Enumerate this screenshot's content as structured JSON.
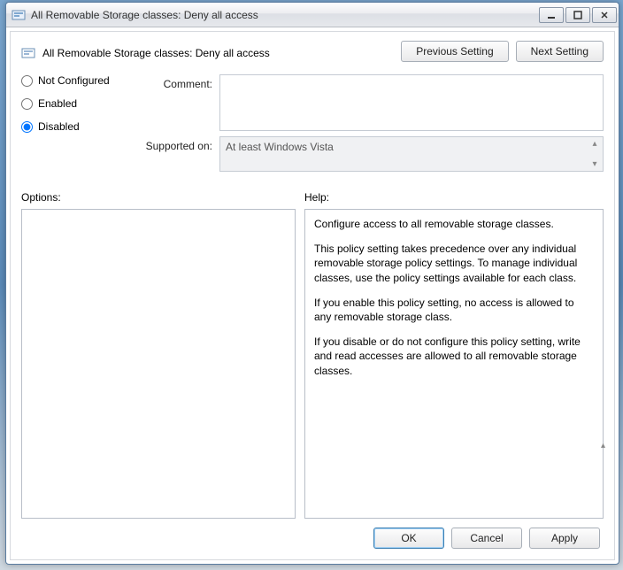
{
  "window": {
    "title": "All Removable Storage classes: Deny all access"
  },
  "header": {
    "policy_title": "All Removable Storage classes: Deny all access",
    "prev_label": "Previous Setting",
    "next_label": "Next Setting"
  },
  "radios": {
    "not_configured": "Not Configured",
    "enabled": "Enabled",
    "disabled": "Disabled",
    "selected": "disabled"
  },
  "fields": {
    "comment_label": "Comment:",
    "comment_value": "",
    "supported_label": "Supported on:",
    "supported_value": "At least Windows Vista"
  },
  "sections": {
    "options_label": "Options:",
    "help_label": "Help:"
  },
  "help": {
    "p1": "Configure access to all removable storage classes.",
    "p2": "This policy setting takes precedence over any individual removable storage policy settings. To manage individual classes, use the policy settings available for each class.",
    "p3": "If you enable this policy setting, no access is allowed to any removable storage class.",
    "p4": "If you disable or do not configure this policy setting, write and read accesses are allowed to all removable storage classes."
  },
  "footer": {
    "ok": "OK",
    "cancel": "Cancel",
    "apply": "Apply"
  }
}
